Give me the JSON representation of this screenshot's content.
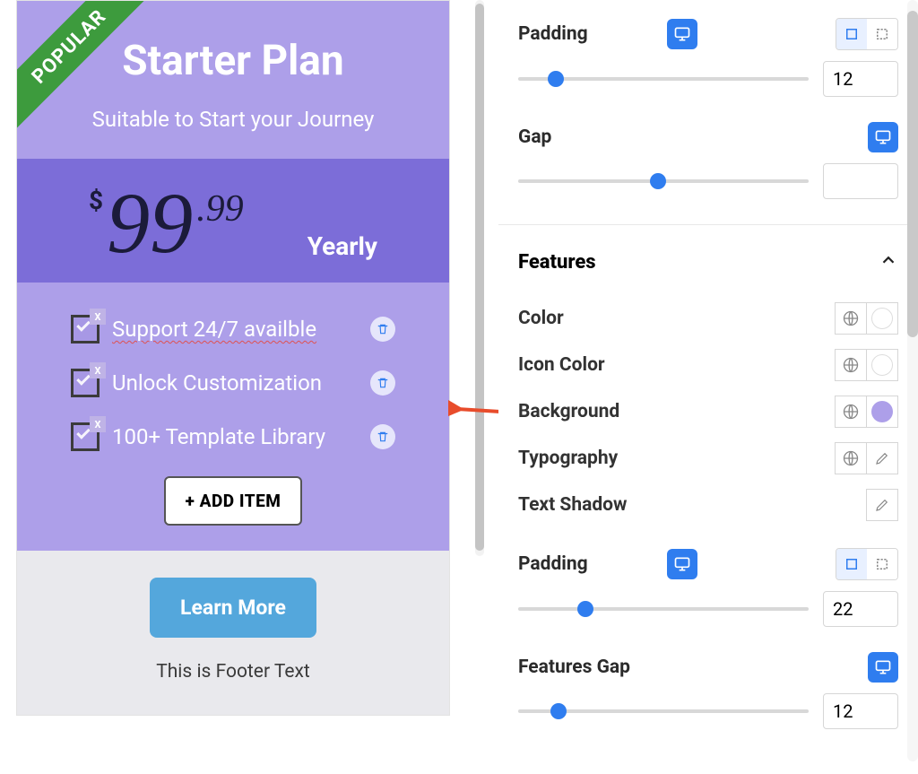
{
  "preview": {
    "ribbon": "POPULAR",
    "title": "Starter Plan",
    "subtitle": "Suitable to Start your Journey",
    "currency": "$",
    "price_main": "99",
    "price_cents": ".99",
    "term": "Yearly",
    "features": [
      "Support 24/7 availble",
      "Unlock Customization",
      "100+ Template Library"
    ],
    "add_item": "+ ADD ITEM",
    "learn_more": "Learn More",
    "footer_text": "This is Footer Text"
  },
  "panel": {
    "top": {
      "padding": {
        "label": "Padding",
        "value": "12",
        "knob_percent": 13
      },
      "gap": {
        "label": "Gap",
        "value": "",
        "knob_percent": 48
      }
    },
    "features_section": {
      "heading": "Features",
      "props": {
        "color": "Color",
        "icon_color": "Icon Color",
        "background": "Background",
        "typography": "Typography",
        "text_shadow": "Text Shadow"
      },
      "colors": {
        "color": "#ffffff",
        "icon_color": "#ffffff",
        "background": "#ad9fe9"
      },
      "padding": {
        "label": "Padding",
        "value": "22",
        "knob_percent": 23
      },
      "features_gap": {
        "label": "Features Gap",
        "value": "12",
        "knob_percent": 14
      }
    }
  }
}
